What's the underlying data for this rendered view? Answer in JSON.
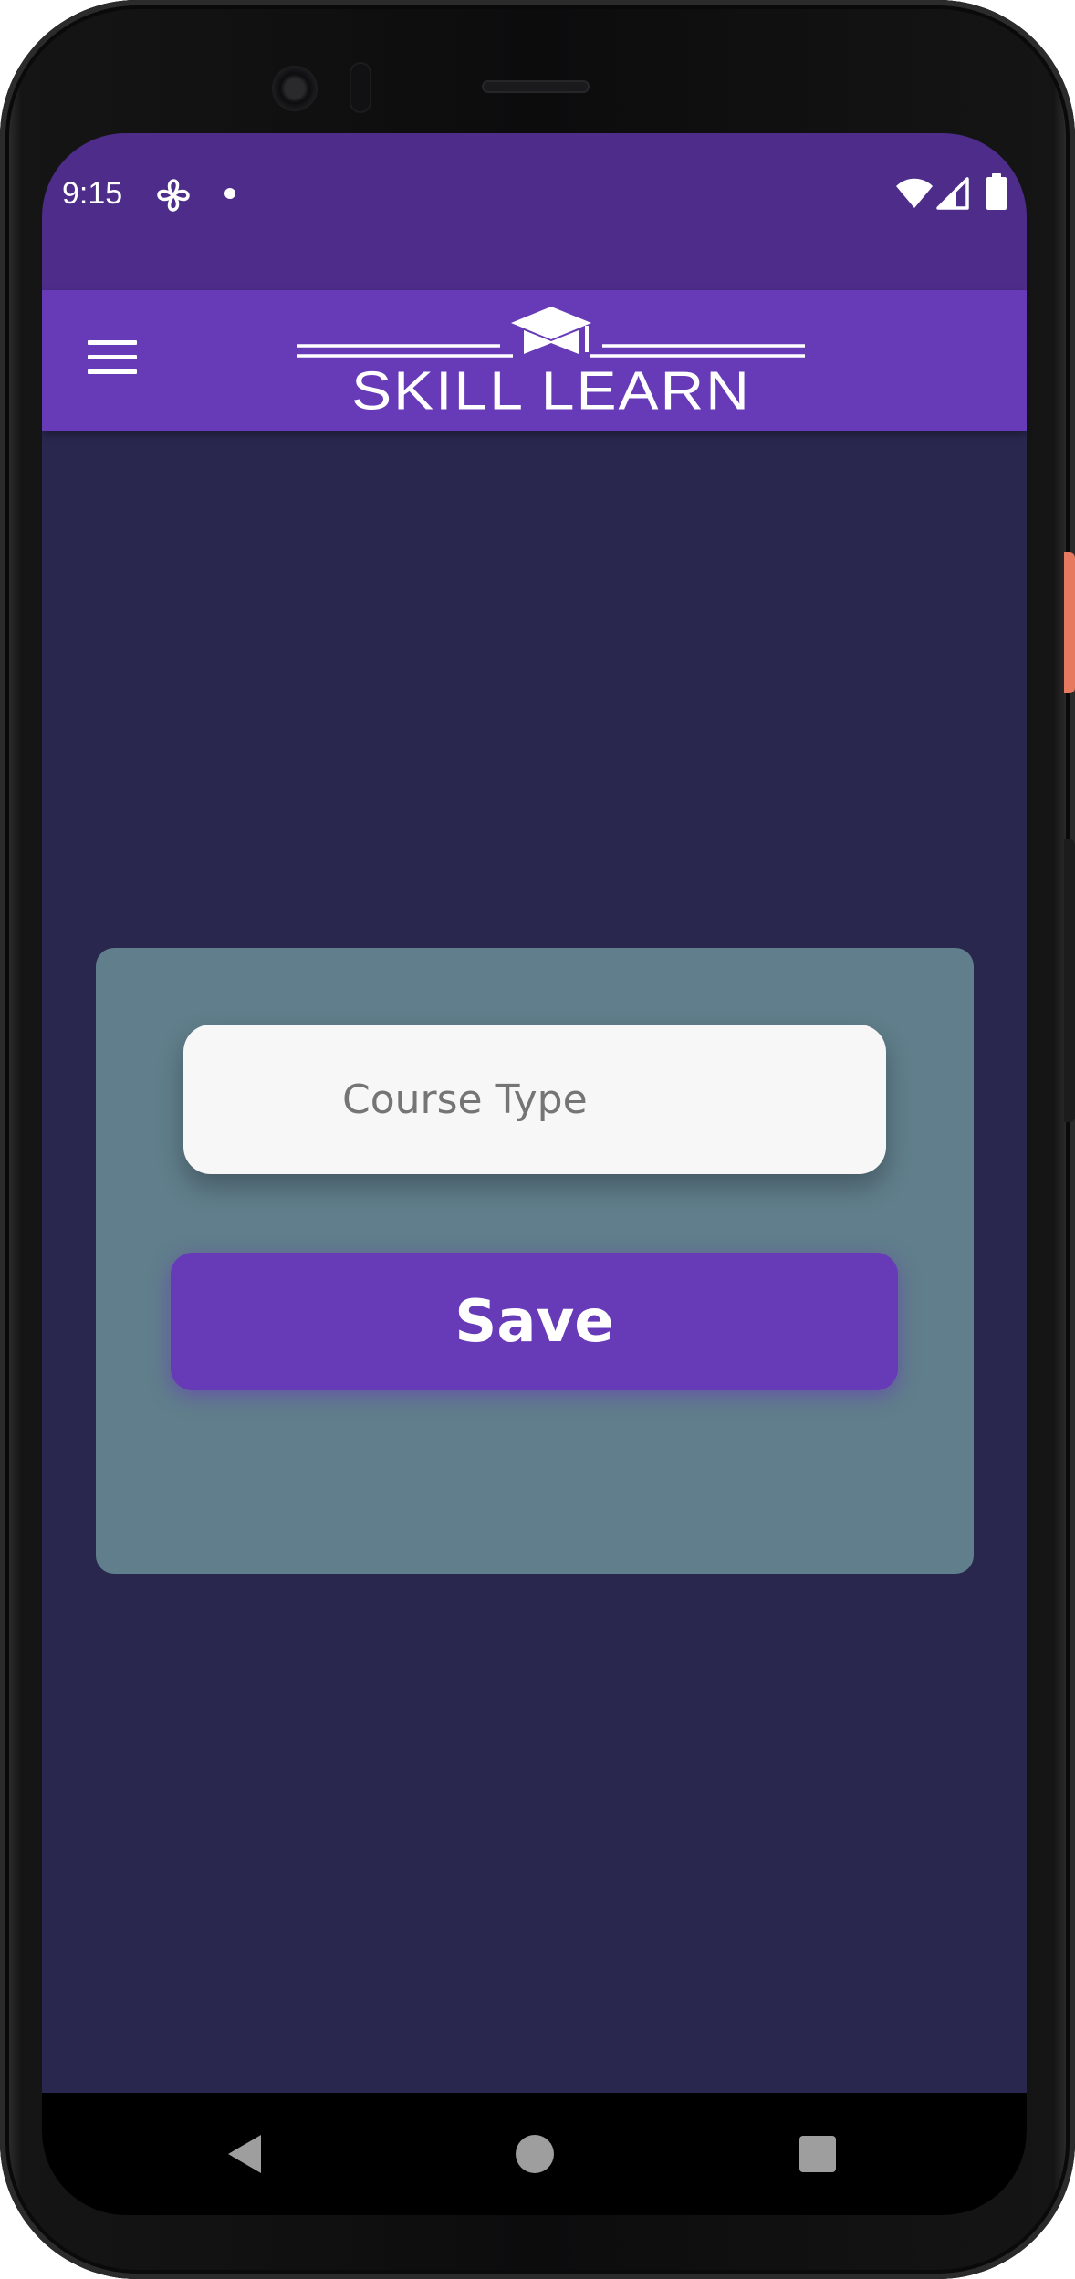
{
  "status_bar": {
    "time": "9:15",
    "icons": [
      "fan-icon",
      "notification-dot-icon",
      "wifi-icon",
      "cellular-signal-icon",
      "battery-icon"
    ]
  },
  "app_bar": {
    "menu_icon": "menu-icon",
    "logo_text": "SKILL LEARN",
    "logo_icon": "graduation-cap-icon"
  },
  "form": {
    "course_type_placeholder": "Course Type",
    "course_type_value": "",
    "save_label": "Save"
  },
  "nav_bar": {
    "icons": [
      "back-icon",
      "home-icon",
      "recents-icon"
    ]
  },
  "colors": {
    "status_bar": "#4d2d89",
    "app_bar": "#673ab7",
    "background": "#29274d",
    "card": "#607e8b",
    "input": "#f7f7f7",
    "button": "#673ab7"
  }
}
